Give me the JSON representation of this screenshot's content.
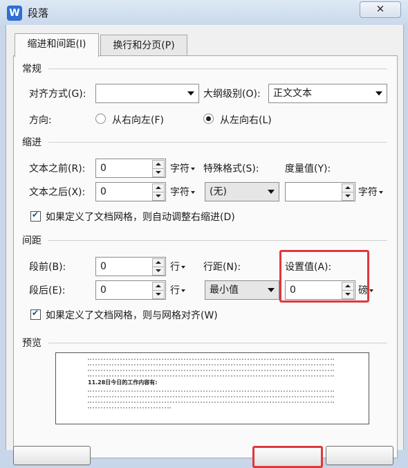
{
  "window": {
    "title": "段落",
    "app_icon": "W",
    "close_glyph": "✕"
  },
  "tabs": [
    {
      "label": "缩进和间距(I)",
      "active": true
    },
    {
      "label": "换行和分页(P)",
      "active": false
    }
  ],
  "general": {
    "section": "常规",
    "align_label": "对齐方式(G):",
    "align_value": "",
    "outline_label": "大纲级别(O):",
    "outline_value": "正文文本",
    "direction_label": "方向:",
    "rtl_label": "从右向左(F)",
    "ltr_label": "从左向右(L)"
  },
  "indent": {
    "section": "缩进",
    "before_label": "文本之前(R):",
    "before_value": "0",
    "before_unit": "字符",
    "after_label": "文本之后(X):",
    "after_value": "0",
    "after_unit": "字符",
    "special_label": "特殊格式(S):",
    "special_value": "(无)",
    "measure_label": "度量值(Y):",
    "measure_value": "",
    "measure_unit": "字符",
    "grid_check_label": "如果定义了文档网格，则自动调整右缩进(D)"
  },
  "spacing": {
    "section": "间距",
    "before_label": "段前(B):",
    "before_value": "0",
    "before_unit": "行",
    "after_label": "段后(E):",
    "after_value": "0",
    "after_unit": "行",
    "line_label": "行距(N):",
    "line_value": "最小值",
    "setting_label": "设置值(A):",
    "setting_value": "0",
    "setting_unit": "磅",
    "grid_check_label": "如果定义了文档网格，则与网格对齐(W)"
  },
  "preview": {
    "section": "预览",
    "sample_text": "11.28日今日的工作内容有:"
  },
  "colors": {
    "highlight": "#e0373b",
    "accent": "#2f6fd3"
  }
}
